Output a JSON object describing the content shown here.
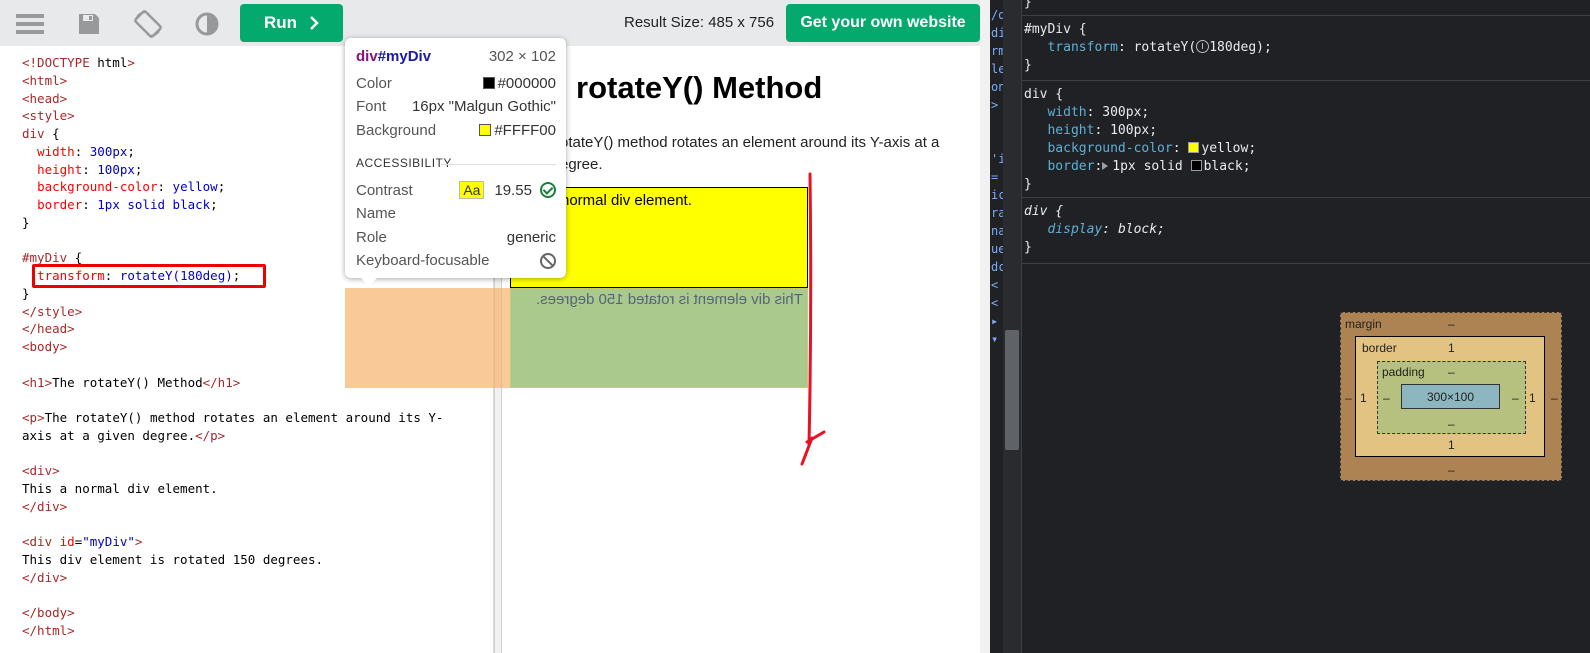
{
  "toolbar": {
    "run_label": "Run",
    "result_size": "Result Size: 485 x 756",
    "cta_label": "Get your own website"
  },
  "code": {
    "lines": [
      "<!DOCTYPE html>",
      "<html>",
      "<head>",
      "<style>",
      "div {",
      "  width: 300px;",
      "  height: 100px;",
      "  background-color: yellow;",
      "  border: 1px solid black;",
      "}",
      "",
      "#myDiv {",
      "  transform: rotateY(180deg);",
      "}",
      "</style>",
      "</head>",
      "<body>",
      "",
      "<h1>The rotateY() Method</h1>",
      "",
      "<p>The rotateY() method rotates an element around its Y-",
      "axis at a given degree.</p>",
      "",
      "<div>",
      "This a normal div element.",
      "</div>",
      "",
      "<div id=\"myDiv\">",
      "This div element is rotated 150 degrees.",
      "</div>",
      "",
      "</body>",
      "</html>"
    ]
  },
  "result": {
    "heading": "rotateY() Method",
    "paragraph": "otateY() method rotates an element around its Y-axis at a egree.",
    "normal_div_text": "normal div element.",
    "rotated_div_text": "This div element is rotated 150 degrees."
  },
  "tooltip": {
    "selector_tag": "div",
    "selector_id": "#myDiv",
    "size": "302 × 102",
    "color_label": "Color",
    "color_value": "#000000",
    "font_label": "Font",
    "font_value": "16px \"Malgun Gothic\"",
    "background_label": "Background",
    "background_value": "#FFFF00",
    "section": "ACCESSIBILITY",
    "contrast_label": "Contrast",
    "contrast_badge": "Aa",
    "contrast_value": "19.55",
    "name_label": "Name",
    "role_label": "Role",
    "role_value": "generic",
    "keyboard_label": "Keyboard-focusable"
  },
  "devtools": {
    "rules": [
      {
        "selector": "#myDiv {",
        "props": [
          {
            "name": "transform",
            "value": "rotateY(",
            "value2": "180deg);"
          }
        ]
      },
      {
        "selector": "div {",
        "props": [
          {
            "name": "width",
            "value": "300px;"
          },
          {
            "name": "height",
            "value": "100px;"
          },
          {
            "name": "background-color",
            "value": "yellow;"
          },
          {
            "name": "border",
            "value": "1px solid ",
            "value2": "black;"
          }
        ]
      },
      {
        "selector": "div {",
        "props": [
          {
            "name": "display",
            "value": "block;"
          }
        ]
      }
    ],
    "box_model": {
      "margin_label": "margin",
      "border_label": "border",
      "padding_label": "padding",
      "content": "300×100",
      "margin_top": "–",
      "margin_bottom": "–",
      "margin_left": "–",
      "margin_right": "–",
      "border_top": "1",
      "border_bottom": "1",
      "border_left": "1",
      "border_right": "1",
      "padding_top": "–",
      "padding_bottom": "–",
      "padding_left": "–",
      "padding_right": "–"
    }
  },
  "colors": {
    "brand_green": "#04AA6D",
    "swatch_black": "#000000",
    "swatch_yellow": "#FFFF00"
  }
}
